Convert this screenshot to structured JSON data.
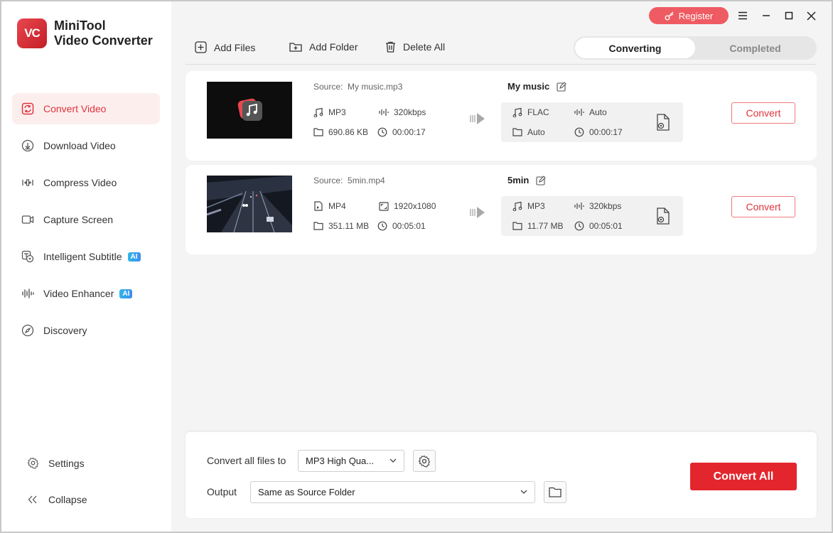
{
  "app": {
    "logo_text": "VC",
    "name_line1": "MiniTool",
    "name_line2": "Video Converter"
  },
  "sidebar": {
    "items": [
      {
        "label": "Convert Video",
        "icon": "convert-icon",
        "active": true
      },
      {
        "label": "Download Video",
        "icon": "download-icon"
      },
      {
        "label": "Compress Video",
        "icon": "compress-icon"
      },
      {
        "label": "Capture Screen",
        "icon": "camera-icon"
      },
      {
        "label": "Intelligent Subtitle",
        "icon": "subtitle-icon",
        "badge": "AI"
      },
      {
        "label": "Video Enhancer",
        "icon": "enhancer-icon",
        "badge": "AI"
      },
      {
        "label": "Discovery",
        "icon": "compass-icon"
      }
    ],
    "settings_label": "Settings",
    "collapse_label": "Collapse"
  },
  "titlebar": {
    "register_label": "Register"
  },
  "toolbar": {
    "add_files": "Add Files",
    "add_folder": "Add Folder",
    "delete_all": "Delete All"
  },
  "tabs": {
    "converting": "Converting",
    "completed": "Completed"
  },
  "tasks": [
    {
      "source_label": "Source:",
      "source_name": "My music.mp3",
      "src_format": "MP3",
      "src_bitrate": "320kbps",
      "src_size": "690.86 KB",
      "src_duration": "00:00:17",
      "out_name": "My music",
      "out_format": "FLAC",
      "out_bitrate": "Auto",
      "out_size": "Auto",
      "out_duration": "00:00:17",
      "convert_label": "Convert"
    },
    {
      "source_label": "Source:",
      "source_name": "5min.mp4",
      "src_format": "MP4",
      "src_resolution": "1920x1080",
      "src_size": "351.11 MB",
      "src_duration": "00:05:01",
      "out_name": "5min",
      "out_format": "MP3",
      "out_bitrate": "320kbps",
      "out_size": "11.77 MB",
      "out_duration": "00:05:01",
      "convert_label": "Convert"
    }
  ],
  "bottom": {
    "convert_all_files_label": "Convert all files to",
    "format_value": "MP3 High Qua...",
    "output_label": "Output",
    "output_value": "Same as Source Folder",
    "convert_all_label": "Convert All"
  },
  "colors": {
    "accent": "#e3262e",
    "active_bg": "#fdeeee",
    "register": "#ef5b62"
  }
}
